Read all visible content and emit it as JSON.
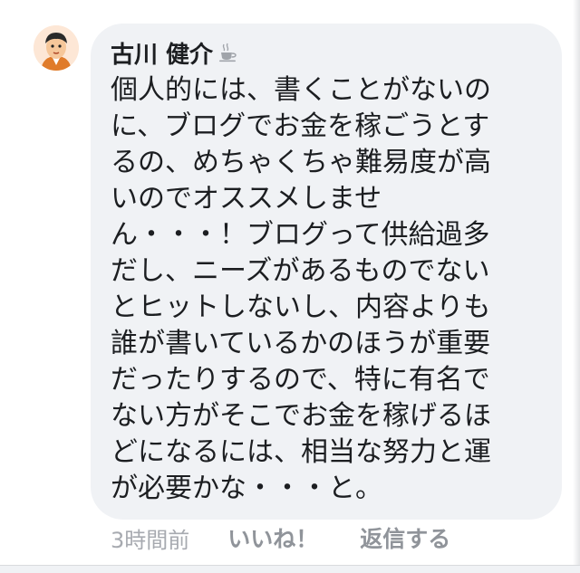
{
  "comment": {
    "author_name": "古川 健介",
    "author_badge_icon": "coffee-cup-icon",
    "avatar_icon": "cartoon-face-icon",
    "lines": [
      "個人的には、書くことがないの",
      "に、ブログでお金を稼ごうとす",
      "るの、めちゃくちゃ難易度が高",
      "いのでオススメしませ",
      "ん・・・！ブログって供給過多",
      "だし、ニーズがあるものでない",
      "とヒットしないし、内容よりも",
      "誰が書いているかのほうが重要",
      "だったりするので、特に有名で",
      "ない方がそこでお金を稼げるほ",
      "どになるには、相当な努力と運",
      "が必要かな・・・と。"
    ]
  },
  "actions": {
    "timestamp": "3時間前",
    "like_label": "いいね！",
    "reply_label": "返信する"
  },
  "colors": {
    "bubble_bg": "#f0f2f5",
    "text": "#1c1e21",
    "meta_text": "#90949a",
    "timestamp_text": "#a7aab0"
  }
}
